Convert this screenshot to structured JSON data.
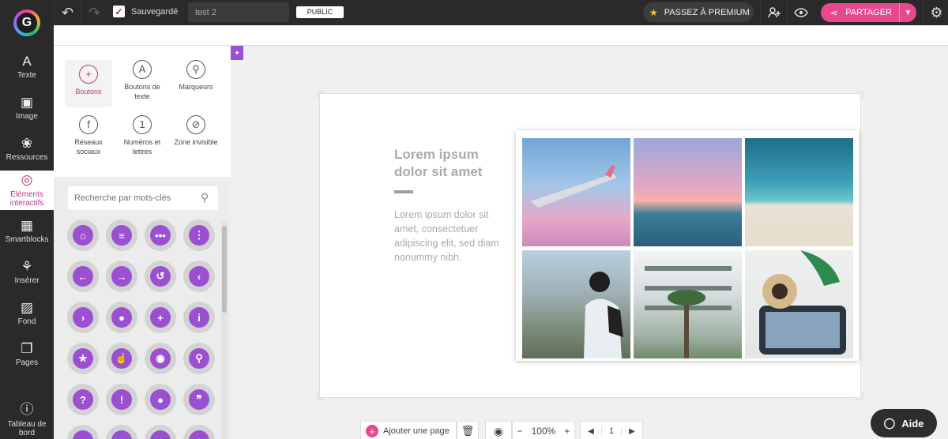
{
  "topbar": {
    "save_status": "Sauvegardé",
    "title_value": "test 2",
    "public_label": "PUBLIC",
    "premium_label": "PASSEZ À PREMIUM",
    "share_label": "PARTAGER"
  },
  "rail": [
    {
      "label": "Texte",
      "icon": "text-icon"
    },
    {
      "label": "Image",
      "icon": "image-icon"
    },
    {
      "label": "Ressources",
      "icon": "resources-icon"
    },
    {
      "label": "Éléments interactifs",
      "icon": "interactive-icon",
      "active": true
    },
    {
      "label": "Smartblocks",
      "icon": "smartblocks-icon"
    },
    {
      "label": "Insérer",
      "icon": "insert-icon"
    },
    {
      "label": "Fond",
      "icon": "background-icon"
    },
    {
      "label": "Pages",
      "icon": "pages-icon"
    },
    {
      "label": "Tableau de bord",
      "icon": "dashboard-icon"
    }
  ],
  "panel": {
    "tiles": [
      {
        "label": "Boutons",
        "icon": "plus-circle-icon"
      },
      {
        "label": "Boutons de texte",
        "icon": "text-button-icon"
      },
      {
        "label": "Marqueurs",
        "icon": "map-pin-icon"
      },
      {
        "label": "Réseaux sociaux",
        "icon": "facebook-icon"
      },
      {
        "label": "Numéros et lettres",
        "icon": "number-icon"
      },
      {
        "label": "Zone invisible",
        "icon": "eye-off-icon"
      }
    ],
    "search_placeholder": "Recherche par mots-clés",
    "buttons": [
      "home",
      "menu",
      "more-h",
      "more-v",
      "arrow-left",
      "arrow-right",
      "undo",
      "chevron-left",
      "chevron-right",
      "stop",
      "plus",
      "info",
      "star",
      "touch",
      "eye",
      "search",
      "question",
      "exclamation",
      "user",
      "quote"
    ]
  },
  "canvas": {
    "heading": "Lorem ipsum dolor sit amet",
    "body": "Lorem ipsum dolor sit amet, consectetuer adipiscing elit, sed diam nonummy nibh."
  },
  "bottom": {
    "add_page": "Ajouter une page",
    "zoom": "100%",
    "page": "1"
  },
  "help_label": "Aide",
  "colors": {
    "accent": "#e8488e",
    "purple": "#9b4fd1",
    "topbar": "#2a2a2a"
  }
}
